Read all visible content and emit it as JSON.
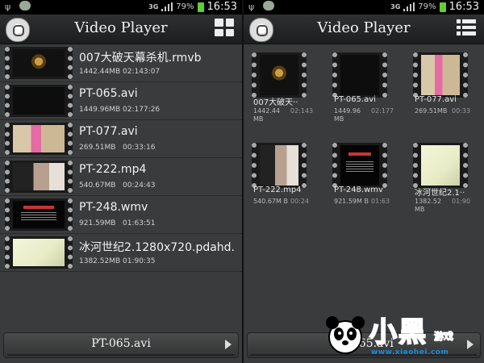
{
  "left": {
    "status": {
      "network": "3G",
      "battery": "79%",
      "time": "16:53"
    },
    "title": "Video Player",
    "videos": [
      {
        "name": "007大破天幕杀机.rmvb",
        "size": "1442.44MB",
        "duration": "02:143:07",
        "thumb": "logo"
      },
      {
        "name": "PT-065.avi",
        "size": "1449.96MB",
        "duration": "02:177:26",
        "thumb": "dark"
      },
      {
        "name": "PT-077.avi",
        "size": "269.51MB",
        "duration": "00:33:16",
        "thumb": "room"
      },
      {
        "name": "PT-222.mp4",
        "size": "540.67MB",
        "duration": "00:24:43",
        "thumb": "people"
      },
      {
        "name": "PT-248.wmv",
        "size": "921.59MB",
        "duration": "01:63:51",
        "thumb": "text"
      },
      {
        "name": "冰河世纪2.1280x720.pdahd.",
        "size": "1382.52MB",
        "duration": "01:90:35",
        "thumb": "bright"
      }
    ],
    "now_playing": "PT-065.avi"
  },
  "right": {
    "status": {
      "network": "3G",
      "battery": "79%",
      "time": "16:53"
    },
    "title": "Video Player",
    "tiles": [
      {
        "name": "007大破天··",
        "size": "1442.44 MB",
        "duration": "02:143",
        "thumb": "logo"
      },
      {
        "name": "PT-065.avi",
        "size": "1449.96 MB",
        "duration": "02:177",
        "thumb": "dark"
      },
      {
        "name": "PT-077.avi",
        "size": "269.51MB",
        "duration": "00:33",
        "thumb": "room"
      },
      {
        "name": "PT-222.mp4",
        "size": "540.67M B",
        "duration": "00:24",
        "thumb": "people"
      },
      {
        "name": "PT-248.wmv",
        "size": "921.59M B",
        "duration": "01:63",
        "thumb": "text"
      },
      {
        "name": "冰河世纪2.1··",
        "size": "1382.52 MB",
        "duration": "01:90",
        "thumb": "bright"
      }
    ],
    "now_playing": "PT-065.avi"
  },
  "watermark": {
    "brand_cn": "小黑",
    "brand_game": "游戏",
    "url": "www.xiaohei.com"
  },
  "colors": {
    "panel": "#3a3b3c",
    "titlebar": "#1c1d1e",
    "accent_blue": "#1a93e8",
    "accent_orange": "#ff8a00"
  }
}
